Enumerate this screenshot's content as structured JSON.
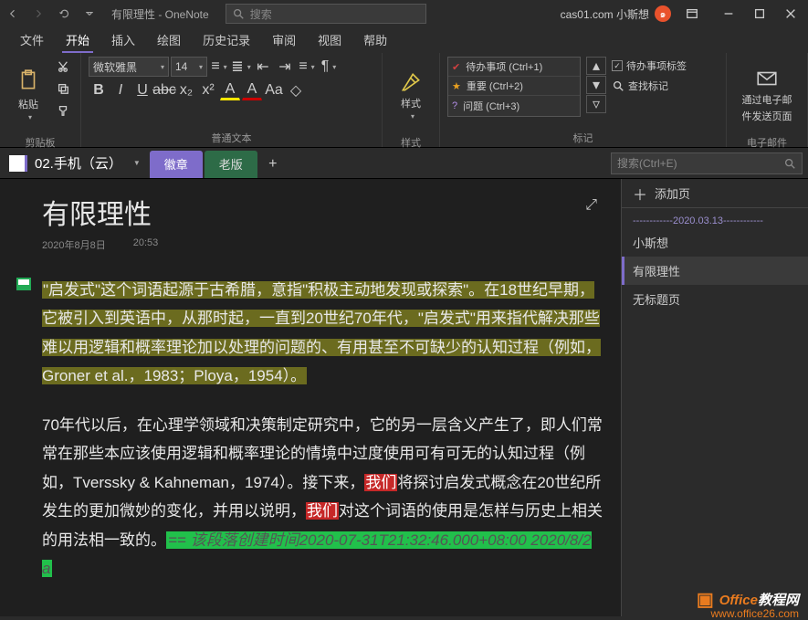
{
  "titlebar": {
    "title": "有限理性 - OneNote",
    "search_placeholder": "搜索",
    "brand": "cas01.com 小斯想"
  },
  "ribbon_tabs": {
    "file": "文件",
    "home": "开始",
    "insert": "插入",
    "draw": "绘图",
    "history": "历史记录",
    "review": "审阅",
    "view": "视图",
    "help": "帮助"
  },
  "ribbon": {
    "clipboard": {
      "label": "剪贴板",
      "paste": "粘贴"
    },
    "font": {
      "label": "普通文本",
      "name": "微软雅黑",
      "size": "14",
      "bold": "B",
      "italic": "I",
      "underline": "U",
      "strike": "abc",
      "sub": "x₂",
      "sup": "x²"
    },
    "styles": {
      "label": "样式",
      "btn": "样式"
    },
    "tags": {
      "label": "标记",
      "items": [
        {
          "glyph": "✔",
          "color": "#d04040",
          "text": "待办事项 (Ctrl+1)"
        },
        {
          "glyph": "★",
          "color": "#e8a020",
          "text": "重要 (Ctrl+2)"
        },
        {
          "glyph": "?",
          "color": "#b48ee8",
          "text": "问题 (Ctrl+3)"
        }
      ],
      "todo_tag": "待办事项标签",
      "find_tag": "查找标记"
    },
    "email": {
      "label": "电子邮件",
      "btn1": "通过电子邮",
      "btn2": "件发送页面"
    }
  },
  "notebook": {
    "name": "02.手机（云）",
    "sections": {
      "active": "徽章",
      "green": "老版"
    },
    "search_placeholder": "搜索(Ctrl+E)"
  },
  "sidebar": {
    "add_page": "添加页",
    "date_divider": "------------2020.03.13------------",
    "items": [
      "小斯想",
      "有限理性",
      "无标题页"
    ]
  },
  "page": {
    "title": "有限理性",
    "date": "2020年8月8日",
    "time": "20:53",
    "para1_a": "\"启发式\"这个词语起源于古希腊，意指\"积极主动地发现或探索\"。在18世纪早期，它被引入到英语中，从那时起，一直到20世纪70年代，\"启发式\"用来指代解决那些难以用逻辑和概率理论加以处理的问题的、有用甚至不可缺少的认知过程（例如，Groner et al.，1983；Ploya，1954）。",
    "para2_a": "70年代以后，在心理学领域和决策制定研究中，它的另一层含义产生了，即人们常常在那些本应该使用逻辑和概率理论的情境中过度使用可有可无的认知过程（例如，Tverssky & Kahneman，1974）。接下来，",
    "we": "我们",
    "para2_b": "将探讨启发式概念在20世纪所发生的更加微妙的变化，并用以说明，",
    "para2_c": "对这个词语的使用是怎样与历史上相关的用法相一致的。",
    "stamp": "== 该段落创建时间2020-07-31T21:32:46.000+08:00 2020/8/2 a"
  },
  "watermark": {
    "t1": "Office",
    "t2": "教程网",
    "url": "www.office26.com"
  }
}
